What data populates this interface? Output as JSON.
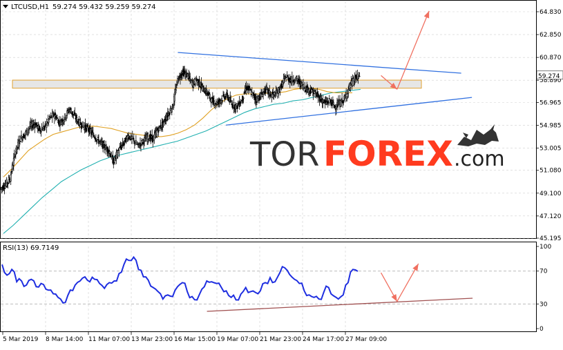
{
  "chart_data": [
    {
      "type": "candlestick",
      "symbol_label": "LTCUSD,H1",
      "ohlc_label": "59.274 59.432 59.259 59.274",
      "current_price": "59.274",
      "y_ticks": [
        "64.830",
        "62.850",
        "60.870",
        "58.890",
        "56.965",
        "54.985",
        "53.005",
        "51.080",
        "49.100",
        "47.120",
        "45.195"
      ],
      "ylim": [
        45.195,
        64.83
      ],
      "x_ticks": [
        "5 Mar 2019",
        "8 Mar 14:00",
        "11 Mar 07:00",
        "13 Mar 23:00",
        "16 Mar 15:00",
        "19 Mar 07:00",
        "21 Mar 23:00",
        "24 Mar 17:00",
        "27 Mar 09:00"
      ],
      "series_approx_close": [
        49.8,
        50.4,
        52.6,
        53.8,
        54.2,
        54.9,
        55.1,
        54.6,
        54.8,
        55.6,
        55.9,
        55.2,
        55.6,
        56.4,
        55.8,
        55.2,
        54.9,
        54.6,
        54.1,
        53.6,
        53.2,
        52.8,
        51.8,
        52.8,
        53.4,
        54.1,
        53.7,
        53.2,
        53.6,
        54.0,
        53.8,
        54.6,
        55.1,
        55.9,
        56.6,
        58.9,
        59.6,
        59.3,
        58.6,
        58.9,
        58.2,
        57.8,
        57.1,
        56.9,
        57.3,
        57.6,
        56.8,
        56.6,
        57.1,
        58.3,
        57.8,
        57.2,
        57.6,
        58.1,
        57.6,
        57.7,
        58.3,
        59.2,
        58.9,
        59.0,
        58.6,
        58.2,
        58.0,
        57.7,
        57.3,
        56.9,
        57.1,
        56.6,
        56.9,
        57.3,
        58.4,
        59.0,
        59.274
      ],
      "ma_fast_approx": [
        50.5,
        51.2,
        52.0,
        52.8,
        53.3,
        53.8,
        54.2,
        54.4,
        54.6,
        54.8,
        54.9,
        54.9,
        54.8,
        54.7,
        54.5,
        54.3,
        54.2,
        54.1,
        54.0,
        54.0,
        54.1,
        54.3,
        54.6,
        55.0,
        55.6,
        56.3,
        56.9,
        57.3,
        57.6,
        57.7,
        57.7,
        57.7,
        57.8,
        57.8,
        57.9,
        58.1,
        58.2,
        58.2,
        58.1,
        57.9,
        57.8,
        57.8,
        57.8
      ],
      "ma_slow_approx": [
        45.6,
        46.3,
        47.1,
        47.9,
        48.7,
        49.4,
        50.1,
        50.6,
        51.1,
        51.5,
        51.9,
        52.2,
        52.4,
        52.6,
        52.8,
        53.0,
        53.2,
        53.4,
        53.6,
        53.9,
        54.2,
        54.5,
        54.9,
        55.3,
        55.7,
        56.1,
        56.4,
        56.6,
        56.8,
        56.9,
        57.1,
        57.2,
        57.4,
        57.6,
        57.8,
        57.9,
        58.0,
        58.1
      ],
      "resistance_zone": [
        58.2,
        58.9
      ],
      "triangle_upper": [
        {
          "index": 0.33,
          "y": 61.3
        },
        {
          "index": 0.86,
          "y": 59.5
        }
      ],
      "triangle_lower": [
        {
          "index": 0.42,
          "y": 55.0
        },
        {
          "index": 0.88,
          "y": 57.4
        }
      ],
      "forecast_arrows": [
        {
          "from_index": 0.71,
          "from_y": 59.3,
          "to_index": 0.74,
          "to_y": 58.1
        },
        {
          "from_index": 0.74,
          "from_y": 58.1,
          "to_index": 0.8,
          "to_y": 64.9
        }
      ]
    },
    {
      "type": "line",
      "title": "RSI(13) 69.7149",
      "y_ticks": [
        "100",
        "70",
        "30",
        "0"
      ],
      "ylim": [
        0,
        100
      ],
      "values_approx": [
        78,
        65,
        72,
        57,
        58,
        53,
        60,
        51,
        55,
        48,
        47,
        42,
        36,
        32,
        47,
        53,
        58,
        63,
        57,
        60,
        55,
        49,
        56,
        58,
        67,
        78,
        83,
        87,
        72,
        63,
        59,
        50,
        45,
        36,
        41,
        39,
        51,
        56,
        45,
        39,
        35,
        48,
        58,
        57,
        55,
        50,
        46,
        38,
        35,
        42,
        50,
        45,
        44,
        46,
        56,
        62,
        57,
        68,
        74,
        66,
        60,
        55,
        46,
        41,
        38,
        36,
        44,
        50,
        40,
        36,
        41,
        56,
        72,
        69.7149
      ],
      "support_line": [
        {
          "index": 0.4,
          "y": 21
        },
        {
          "index": 0.92,
          "y": 37
        }
      ],
      "forecast_arrows": [
        {
          "from_index": 0.71,
          "from_y": 68,
          "to_index": 0.74,
          "to_y": 33
        },
        {
          "from_index": 0.74,
          "from_y": 33,
          "to_index": 0.78,
          "to_y": 79
        }
      ]
    }
  ],
  "watermark": {
    "prefix": "TOR",
    "main": "FOREX",
    "suffix": ".com"
  },
  "colors": {
    "bull_candle": "#000000",
    "bear_candle": "#000000",
    "ma_fast": "#e0a020",
    "ma_slow": "#20b0b0",
    "trendline": "#3070e0",
    "zone_fill": "#e6e6e6",
    "zone_border": "#e0a030",
    "forecast_arrow": "#f07060",
    "rsi_line": "#1e2ee0",
    "rsi_support": "#a05050",
    "grid": "#cfcfcf"
  }
}
